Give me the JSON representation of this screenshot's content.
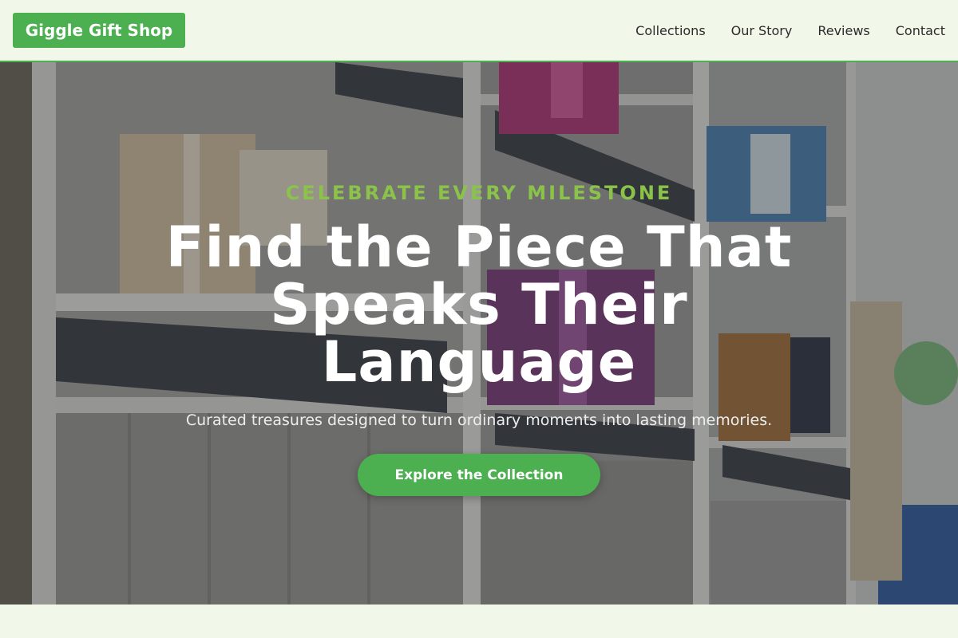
{
  "header": {
    "logo": "Giggle Gift Shop",
    "nav": [
      "Collections",
      "Our Story",
      "Reviews",
      "Contact"
    ]
  },
  "hero": {
    "eyebrow": "CELEBRATE EVERY MILESTONE",
    "headline": "Find the Piece That Speaks Their Language",
    "subheadline": "Curated treasures designed to turn ordinary moments into lasting memories.",
    "cta": "Explore the Collection",
    "background_image": "gift-shop-shelves-photo"
  },
  "colors": {
    "brand_green": "#4caf50",
    "eyebrow_green": "#8bc34a",
    "page_background": "#f1f8e9"
  }
}
